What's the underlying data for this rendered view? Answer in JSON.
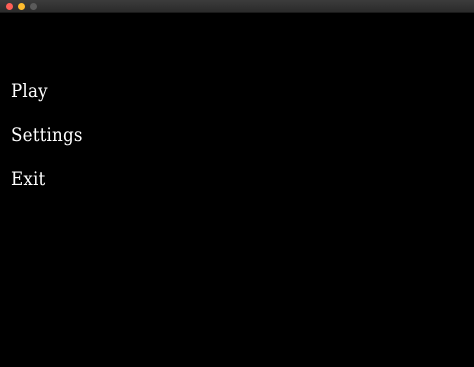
{
  "window": {
    "controls": {
      "close": "close-dot",
      "minimize": "minimize-dot",
      "zoom": "zoom-dot"
    },
    "colors": {
      "background": "#000000",
      "text": "#ffffff",
      "close": "#ff5f57",
      "minimize": "#febc2e",
      "zoom": "#5a5a5a"
    }
  },
  "menu": {
    "items": [
      {
        "label": "Play"
      },
      {
        "label": "Settings"
      },
      {
        "label": "Exit"
      }
    ]
  }
}
